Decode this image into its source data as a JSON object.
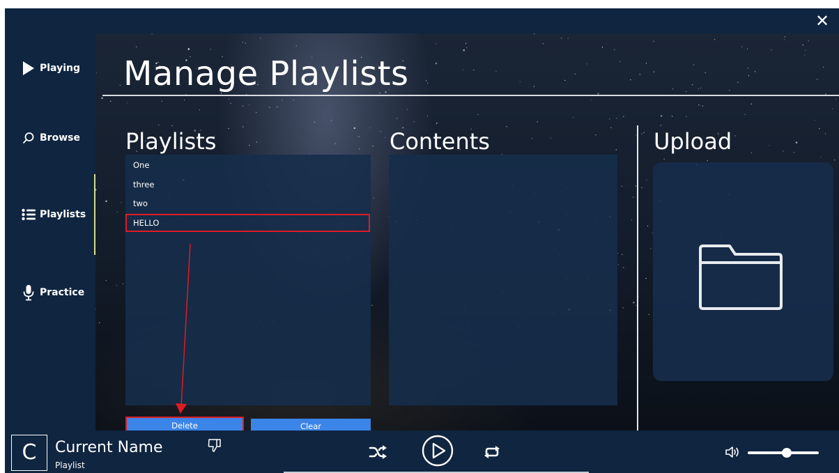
{
  "window": {
    "close_label": "✕"
  },
  "sidebar": {
    "items": [
      {
        "id": "playing",
        "label": "Playing",
        "icon": "play-triangle-icon"
      },
      {
        "id": "browse",
        "label": "Browse",
        "icon": "search-icon"
      },
      {
        "id": "playlists",
        "label": "Playlists",
        "icon": "list-icon",
        "active": true
      },
      {
        "id": "practice",
        "label": "Practice",
        "icon": "microphone-icon"
      }
    ],
    "active_color": "#d8dd8a"
  },
  "main": {
    "title": "Manage Playlists",
    "playlists": {
      "heading": "Playlists",
      "items": [
        "One",
        "three",
        "two",
        "HELLO"
      ],
      "selected": "HELLO",
      "delete_label": "Delete",
      "clear_label": "Clear"
    },
    "contents": {
      "heading": "Contents"
    },
    "upload": {
      "heading": "Upload",
      "icon": "folder-icon"
    }
  },
  "player": {
    "avatar_letter": "C",
    "track_name": "Current Name",
    "track_subtitle": "Playlist",
    "volume_level": 0.55
  },
  "colors": {
    "background": "#0f2540",
    "button": "#3b84e8",
    "highlight": "#e01b24"
  }
}
